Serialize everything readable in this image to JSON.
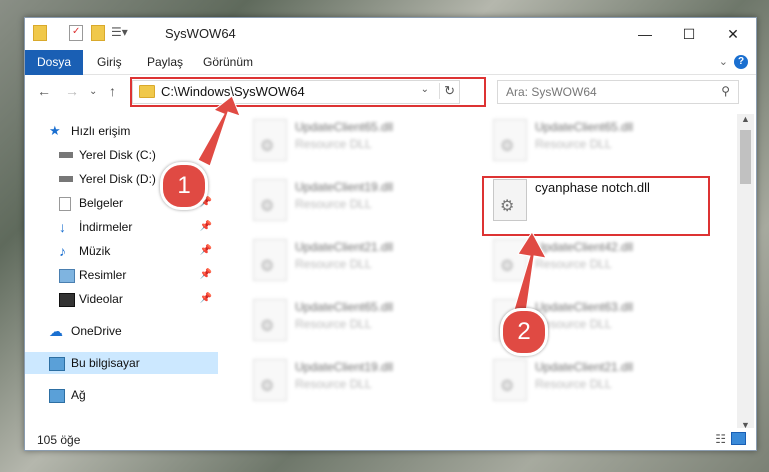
{
  "window": {
    "title": "SysWOW64",
    "controls": {
      "minimize": "—",
      "maximize": "☐",
      "close": "✕"
    }
  },
  "ribbon": {
    "tabs": [
      "Dosya",
      "Giriş",
      "Paylaş",
      "Görünüm"
    ],
    "help": "?"
  },
  "navigation": {
    "address": "C:\\Windows\\SysWOW64",
    "search_placeholder": "Ara: SysWOW64"
  },
  "sidebar": {
    "items": [
      {
        "label": "Hızlı erişim",
        "icon": "star-icon"
      },
      {
        "label": "Yerel Disk (C:)",
        "icon": "drive-icon"
      },
      {
        "label": "Yerel Disk (D:)",
        "icon": "drive-icon"
      },
      {
        "label": "Belgeler",
        "icon": "documents-icon"
      },
      {
        "label": "İndirmeler",
        "icon": "download-icon"
      },
      {
        "label": "Müzik",
        "icon": "music-icon"
      },
      {
        "label": "Resimler",
        "icon": "pictures-icon"
      },
      {
        "label": "Videolar",
        "icon": "videos-icon"
      },
      {
        "label": "OneDrive",
        "icon": "cloud-icon"
      },
      {
        "label": "Bu bilgisayar",
        "icon": "computer-icon"
      },
      {
        "label": "Ağ",
        "icon": "network-icon"
      }
    ]
  },
  "files": {
    "col1": [
      {
        "name": "UpdateClient65.dll",
        "desc": "Resource DLL"
      },
      {
        "name": "UpdateClient19.dll",
        "desc": "Resource DLL"
      },
      {
        "name": "UpdateClient21.dll",
        "desc": "Resource DLL"
      },
      {
        "name": "UpdateClient65.dll",
        "desc": "Resource DLL"
      },
      {
        "name": "UpdateClient19.dll",
        "desc": "Resource DLL"
      }
    ],
    "col2": [
      {
        "name": "UpdateClient65.dll",
        "desc": "Resource DLL"
      },
      {
        "name": "cyanphase notch.dll",
        "desc": ""
      },
      {
        "name": "UpdateClient42.dll",
        "desc": "Resource DLL"
      },
      {
        "name": "UpdateClient63.dll",
        "desc": "Resource DLL"
      },
      {
        "name": "UpdateClient21.dll",
        "desc": "Resource DLL"
      }
    ]
  },
  "status": {
    "count": "105 öğe"
  },
  "annotations": {
    "badge1": "1",
    "badge2": "2"
  },
  "colors": {
    "accent": "#1a5fb4",
    "highlight": "#d33333",
    "selected": "#cce8ff"
  }
}
